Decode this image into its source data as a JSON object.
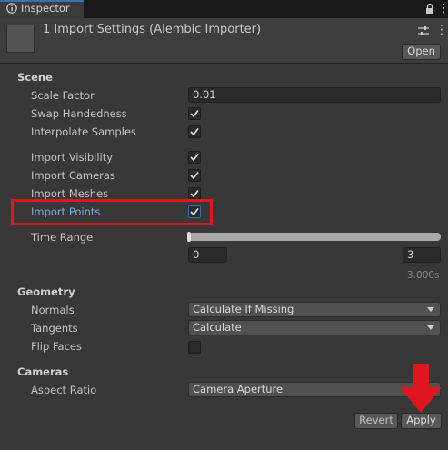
{
  "tab": {
    "label": "Inspector"
  },
  "header": {
    "title": "1 Import Settings (Alembic Importer)",
    "open_label": "Open"
  },
  "scene": {
    "section": "Scene",
    "scale_factor_label": "Scale Factor",
    "scale_factor_value": "0.01",
    "swap_handedness_label": "Swap Handedness",
    "swap_handedness": true,
    "interpolate_samples_label": "Interpolate Samples",
    "interpolate_samples": true,
    "import_visibility_label": "Import Visibility",
    "import_visibility": true,
    "import_cameras_label": "Import Cameras",
    "import_cameras": true,
    "import_meshes_label": "Import Meshes",
    "import_meshes": true,
    "import_points_label": "Import Points",
    "import_points": true,
    "time_range_label": "Time Range",
    "time_range_start": "0",
    "time_range_end": "3",
    "duration": "3.000s"
  },
  "geometry": {
    "section": "Geometry",
    "normals_label": "Normals",
    "normals_value": "Calculate If Missing",
    "tangents_label": "Tangents",
    "tangents_value": "Calculate",
    "flip_faces_label": "Flip Faces",
    "flip_faces": false
  },
  "cameras": {
    "section": "Cameras",
    "aspect_ratio_label": "Aspect Ratio",
    "aspect_ratio_value": "Camera Aperture"
  },
  "footer": {
    "revert_label": "Revert",
    "apply_label": "Apply"
  },
  "colors": {
    "highlight": "#e0161e",
    "selected_label": "#7fa7e0",
    "background": "#383838"
  },
  "icons": [
    "info-icon",
    "lock-icon",
    "more-menu-icon",
    "settings-sliders-icon",
    "checkmark-icon",
    "dropdown-arrow-icon",
    "red-arrow-annotation"
  ]
}
